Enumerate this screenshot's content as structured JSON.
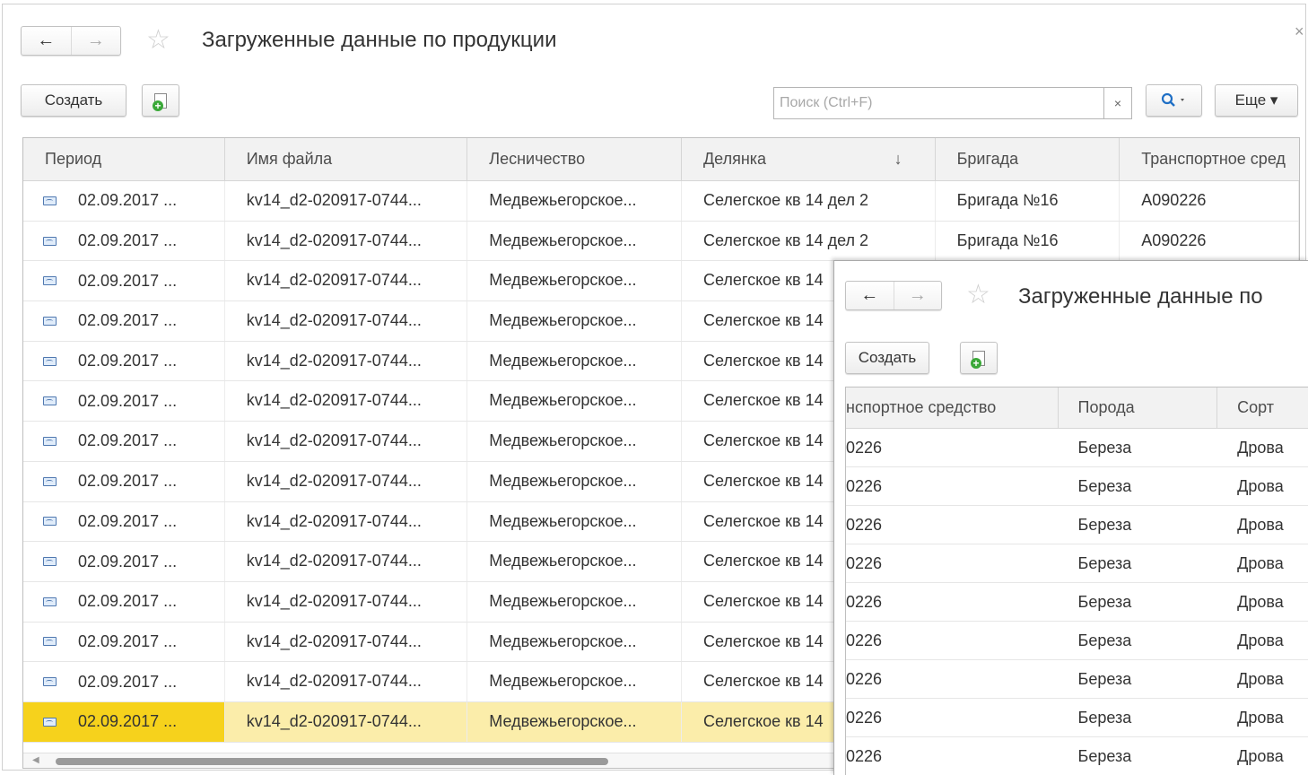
{
  "main": {
    "title": "Загруженные данные по продукции",
    "toolbar": {
      "create_label": "Создать",
      "search_placeholder": "Поиск (Ctrl+F)",
      "clear_label": "×",
      "more_label": "Еще ▾"
    },
    "columns": [
      "Период",
      "Имя файла",
      "Лесничество",
      "Делянка",
      "Бригада",
      "Транспортное сред"
    ],
    "sort_indicator": "↓",
    "rows": [
      [
        "02.09.2017 ...",
        "kv14_d2-020917-0744...",
        "Медвежьегорское...",
        "Селегское кв 14 дел 2",
        "Бригада №16",
        "А090226"
      ],
      [
        "02.09.2017 ...",
        "kv14_d2-020917-0744...",
        "Медвежьегорское...",
        "Селегское кв 14 дел 2",
        "Бригада №16",
        "А090226"
      ],
      [
        "02.09.2017 ...",
        "kv14_d2-020917-0744...",
        "Медвежьегорское...",
        "Селегское кв 14",
        "",
        ""
      ],
      [
        "02.09.2017 ...",
        "kv14_d2-020917-0744...",
        "Медвежьегорское...",
        "Селегское кв 14",
        "",
        ""
      ],
      [
        "02.09.2017 ...",
        "kv14_d2-020917-0744...",
        "Медвежьегорское...",
        "Селегское кв 14",
        "",
        ""
      ],
      [
        "02.09.2017 ...",
        "kv14_d2-020917-0744...",
        "Медвежьегорское...",
        "Селегское кв 14",
        "",
        ""
      ],
      [
        "02.09.2017 ...",
        "kv14_d2-020917-0744...",
        "Медвежьегорское...",
        "Селегское кв 14",
        "",
        ""
      ],
      [
        "02.09.2017 ...",
        "kv14_d2-020917-0744...",
        "Медвежьегорское...",
        "Селегское кв 14",
        "",
        ""
      ],
      [
        "02.09.2017 ...",
        "kv14_d2-020917-0744...",
        "Медвежьегорское...",
        "Селегское кв 14",
        "",
        ""
      ],
      [
        "02.09.2017 ...",
        "kv14_d2-020917-0744...",
        "Медвежьегорское...",
        "Селегское кв 14",
        "",
        ""
      ],
      [
        "02.09.2017 ...",
        "kv14_d2-020917-0744...",
        "Медвежьегорское...",
        "Селегское кв 14",
        "",
        ""
      ],
      [
        "02.09.2017 ...",
        "kv14_d2-020917-0744...",
        "Медвежьегорское...",
        "Селегское кв 14",
        "",
        ""
      ],
      [
        "02.09.2017 ...",
        "kv14_d2-020917-0744...",
        "Медвежьегорское...",
        "Селегское кв 14",
        "",
        ""
      ],
      [
        "02.09.2017 ...",
        "kv14_d2-020917-0744...",
        "Медвежьегорское...",
        "Селегское кв 14",
        "",
        ""
      ]
    ],
    "selected_row": 13
  },
  "overlay": {
    "title": "Загруженные данные по",
    "create_label": "Создать",
    "columns": [
      "нспортное средство",
      "Порода",
      "Сорт"
    ],
    "rows": [
      [
        "0226",
        "Береза",
        "Дрова"
      ],
      [
        "0226",
        "Береза",
        "Дрова"
      ],
      [
        "0226",
        "Береза",
        "Дрова"
      ],
      [
        "0226",
        "Береза",
        "Дрова"
      ],
      [
        "0226",
        "Береза",
        "Дрова"
      ],
      [
        "0226",
        "Береза",
        "Дрова"
      ],
      [
        "0226",
        "Береза",
        "Дрова"
      ],
      [
        "0226",
        "Береза",
        "Дрова"
      ],
      [
        "0226",
        "Береза",
        "Дрова"
      ]
    ]
  },
  "colors": {
    "selected_row_bg": "#fbedaa",
    "selected_cell_bg": "#f6d21c",
    "search_icon": "#1f6fc5",
    "add_icon_green": "#3aa838"
  },
  "icons": {
    "back": "back-arrow-icon",
    "forward": "forward-arrow-icon",
    "favorite": "star-icon",
    "close": "close-icon",
    "add": "add-document-icon",
    "search": "search-icon",
    "row": "record-icon"
  }
}
